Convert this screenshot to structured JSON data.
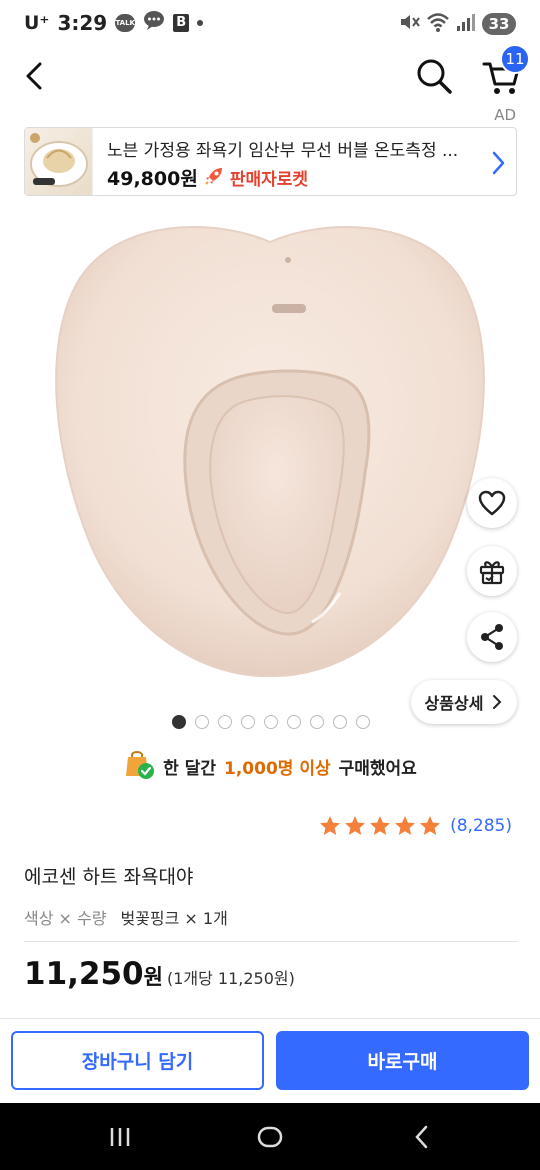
{
  "status_bar": {
    "carrier": "U⁺",
    "time": "3:29",
    "talk_label": "TALK",
    "b_label": "B",
    "battery": "33"
  },
  "header": {
    "cart_badge": "11"
  },
  "ad": {
    "label": "AD",
    "title": "노븐 가정용 좌욕기 임산부 무선 버블 온도측정 ...",
    "price": "49,800원",
    "rocket_text": "판매자로켓"
  },
  "floating": {
    "detail_label": "상품상세"
  },
  "carousel": {
    "total": 9,
    "active": 0
  },
  "purchase_stat": {
    "prefix": "한 달간",
    "highlight": "1,000명 이상",
    "suffix": "구매했어요"
  },
  "rating": {
    "stars": 5,
    "count": "(8,285)"
  },
  "product": {
    "name": "에코센 하트 좌욕대야",
    "option_label": "색상 × 수량",
    "option_value": "벚꽃핑크 × 1개",
    "price": "11,250",
    "currency": "원",
    "unit_price": "(1개당 11,250원)"
  },
  "actions": {
    "cart_label": "장바구니 담기",
    "buy_label": "바로구매"
  },
  "colors": {
    "accent": "#346aff",
    "badge": "#2a64f2",
    "star": "#f4803b",
    "highlight": "#e06a00",
    "rocket": "#e4412f"
  }
}
